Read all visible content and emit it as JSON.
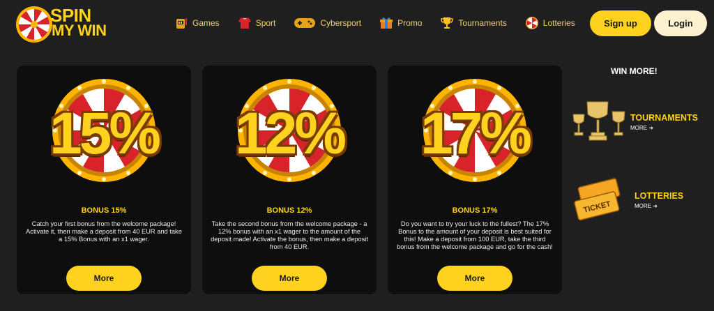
{
  "brand": {
    "line1": "SPIN",
    "line2": "MY WIN"
  },
  "nav": [
    {
      "label": "Games",
      "icon": "slot-machine-icon"
    },
    {
      "label": "Sport",
      "icon": "jersey-icon"
    },
    {
      "label": "Cybersport",
      "icon": "gamepad-icon"
    },
    {
      "label": "Promo",
      "icon": "gift-icon"
    },
    {
      "label": "Tournaments",
      "icon": "trophy-icon"
    },
    {
      "label": "Lotteries",
      "icon": "lottery-wheel-icon"
    }
  ],
  "auth": {
    "signup": "Sign up",
    "login": "Login"
  },
  "cards": [
    {
      "percent": "15%",
      "title": "BONUS 15%",
      "desc": "Catch your first bonus from the welcome package! Activate it, then make a deposit from 40 EUR and take a 15% Bonus with an x1 wager.",
      "more": "More"
    },
    {
      "percent": "12%",
      "title": "BONUS 12%",
      "desc": "Take the second bonus from the welcome package - a 12% bonus with an x1 wager to the amount of the deposit made! Activate the bonus, then make a deposit from 40 EUR.",
      "more": "More"
    },
    {
      "percent": "17%",
      "title": "BONUS 17%",
      "desc": "Do you want to try your luck to the fullest? The 17% Bonus to the amount of your deposit is best suited for this! Make a deposit from 100 EUR, take the third bonus from the welcome package and go for the cash!",
      "more": "More"
    }
  ],
  "sidebar": {
    "title": "WIN MORE!",
    "tournaments": {
      "title": "TOURNAMENTS",
      "more": "MORE ➜"
    },
    "lotteries": {
      "title": "LOTTERIES",
      "more": "MORE ➜",
      "ticket_text": "TICKET"
    }
  },
  "colors": {
    "accent": "#ffd21f",
    "background": "#1f1f1f",
    "card": "#0e0e0e",
    "wheel_red": "#d8232a"
  }
}
